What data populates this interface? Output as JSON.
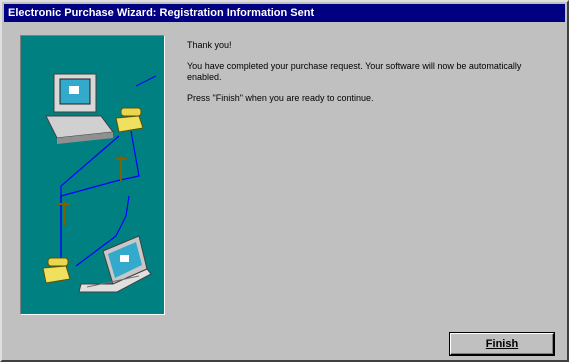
{
  "window": {
    "title": "Electronic Purchase Wizard: Registration Information Sent"
  },
  "content": {
    "thanks": "Thank you!",
    "completed": "You have completed your purchase request. Your software will now be automatically enabled.",
    "instruction": "Press \"Finish\" when you are ready to continue."
  },
  "buttons": {
    "finish": "Finish"
  },
  "colors": {
    "titlebar": "#000080",
    "panel_bg": "#008080",
    "dialog_bg": "#c0c0c0"
  }
}
